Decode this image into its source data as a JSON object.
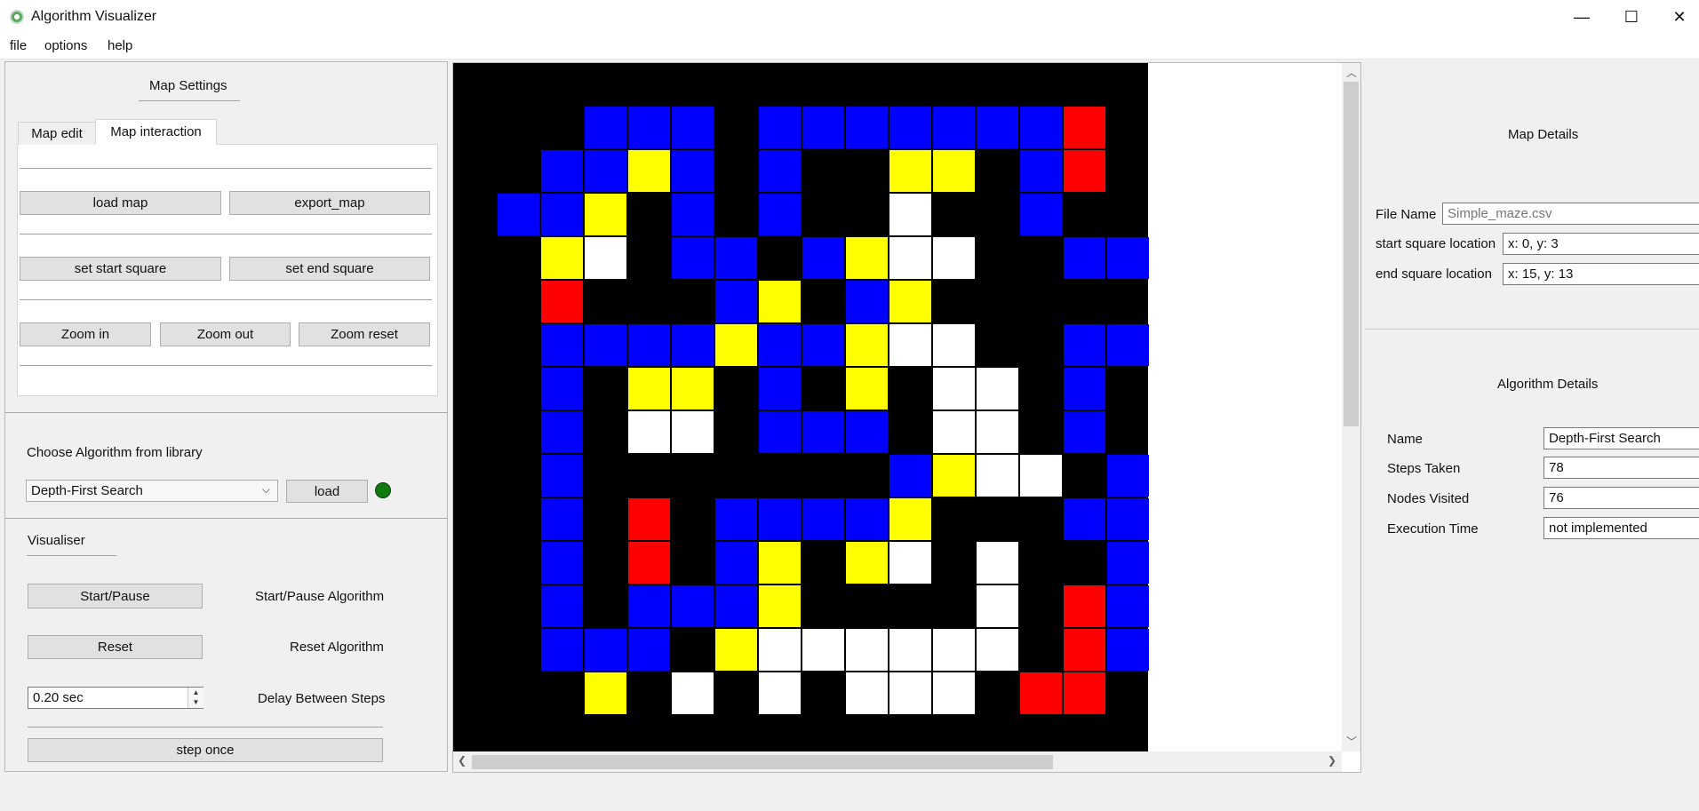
{
  "window": {
    "title": "Algorithm Visualizer",
    "minimize": "—",
    "maximize": "☐",
    "close": "✕"
  },
  "menu": [
    "file",
    "options",
    "help"
  ],
  "map_settings": {
    "title": "Map Settings",
    "tabs": [
      "Map edit",
      "Map interaction"
    ],
    "active_tab": "Map interaction",
    "load_map": "load map",
    "export_map": "export_map",
    "set_start": "set start square",
    "set_end": "set end square",
    "zoom_in": "Zoom in",
    "zoom_out": "Zoom out",
    "zoom_reset": "Zoom reset"
  },
  "algorithm_library": {
    "label": "Choose Algorithm from library",
    "selected": "Depth-First Search",
    "load": "load",
    "status_color": "#0d7a0d"
  },
  "visualiser": {
    "title": "Visualiser",
    "start_pause": "Start/Pause",
    "start_pause_desc": "Start/Pause Algorithm",
    "reset": "Reset",
    "reset_desc": "Reset Algorithm",
    "delay_value": "0.20 sec",
    "delay_desc": "Delay Between Steps",
    "step_once": "step once"
  },
  "map_details": {
    "title": "Map Details",
    "file_name_label": "File Name",
    "file_name_placeholder": "Simple_maze.csv",
    "start_label": "start square location",
    "start_value": "x: 0, y: 3",
    "end_label": "end  square location",
    "end_value": "x: 15, y: 13"
  },
  "algorithm_details": {
    "title": "Algorithm Details",
    "name_label": "Name",
    "name_value": "Depth-First Search",
    "steps_label": "Steps Taken",
    "steps_value": "78",
    "nodes_label": "Nodes Visited",
    "nodes_value": "76",
    "time_label": "Execution Time",
    "time_value": "not implemented"
  },
  "colors": {
    "wall": "#000000",
    "blue": "#0000ff",
    "yellow": "#ffff00",
    "white": "#ffffff",
    "red": "#ff0000"
  },
  "maze": {
    "cols": 16,
    "rows": 15,
    "legend": {
      "B": "blue",
      "Y": "yellow",
      "W": "white",
      "R": "red",
      ".": "wall"
    },
    "grid": [
      "................",
      "...BBB.BBBBBBBR.",
      "..BBYB.B..YY.BR.",
      ".BBY.B.B..W..B..",
      "..YW.BB.BYWW..BB",
      "..R...BY.BY.....B",
      "..BBBBYBBYWW..BB",
      "..B.YY.B.Y.WW.B.",
      "..B.WW.BBB.WW.B.",
      "..B.......BYWW.B.",
      "..B.R.BBBBY...BB",
      "..B.R.BY.YW.W..B",
      "..B.BBBY....W.RB",
      "..BBB.YWWWWWW.RBB",
      "...Y.W.W.WWW.RR."
    ]
  }
}
